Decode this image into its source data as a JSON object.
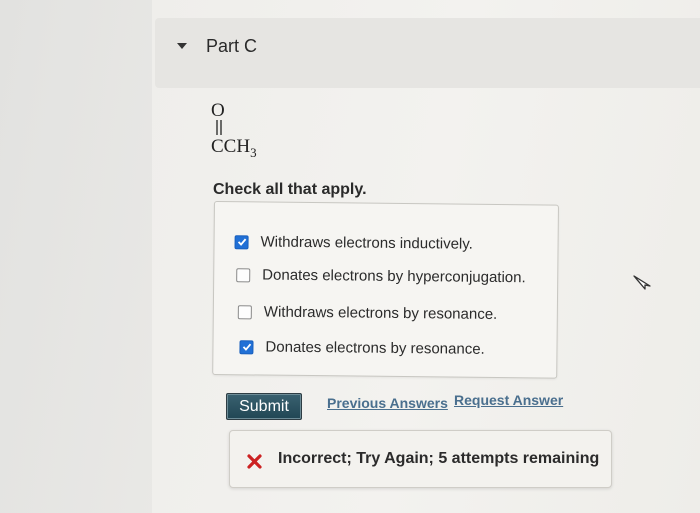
{
  "part": {
    "title": "Part C"
  },
  "molecule": {
    "oxygen": "O",
    "group_main": "CCH",
    "group_sub": "3"
  },
  "question": {
    "instruction": "Check all that apply."
  },
  "options": [
    {
      "label": "Withdraws electrons inductively.",
      "checked": true
    },
    {
      "label": "Donates electrons by hyperconjugation.",
      "checked": false
    },
    {
      "label": "Withdraws electrons by resonance.",
      "checked": false
    },
    {
      "label": "Donates electrons by resonance.",
      "checked": true
    }
  ],
  "actions": {
    "submit_label": "Submit",
    "previous_answers_label": "Previous Answers",
    "request_answer_label": "Request Answer"
  },
  "feedback": {
    "message": "Incorrect; Try Again; 5 attempts remaining",
    "status_color": "#cc2222"
  },
  "colors": {
    "checkbox_checked": "#2170d6",
    "link": "#4a6f8e",
    "submit_bg": "#2a4f5e"
  }
}
